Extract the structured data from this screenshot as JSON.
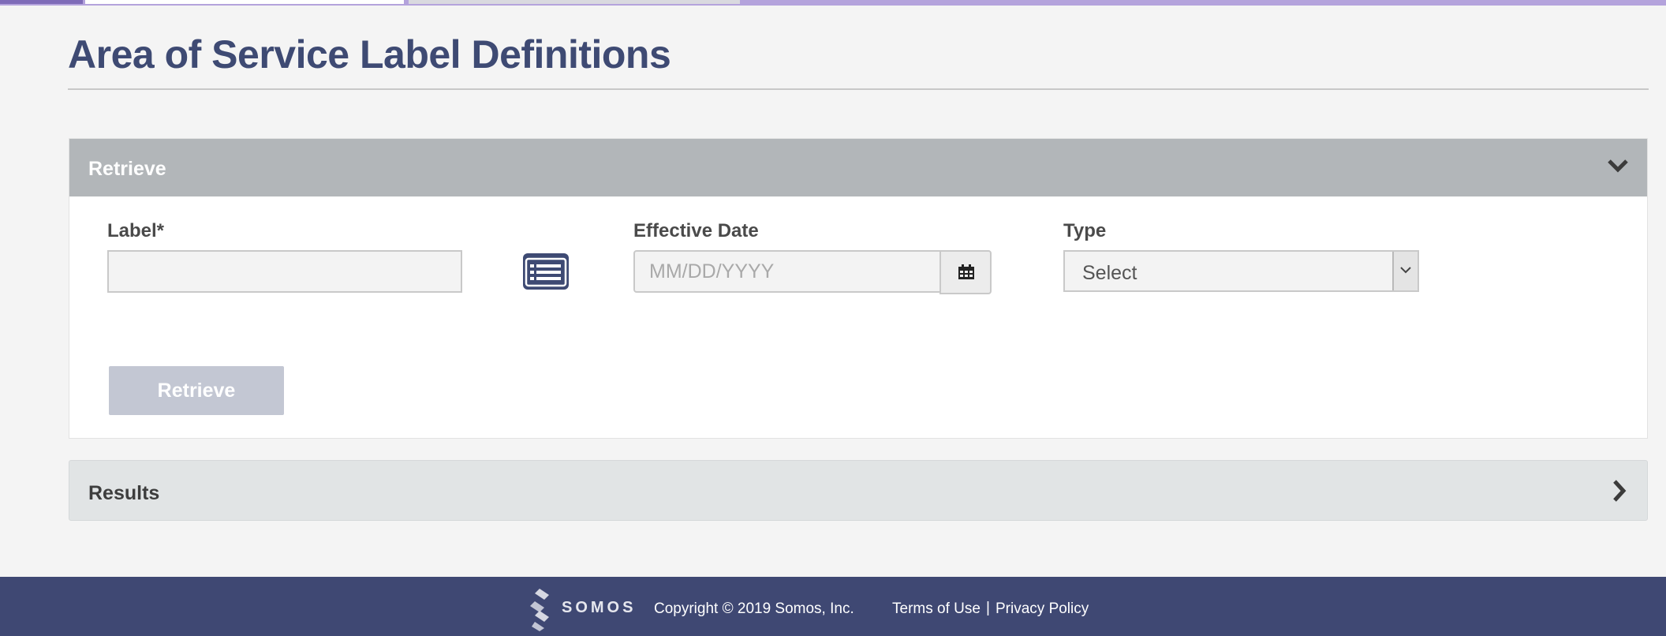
{
  "page": {
    "title": "Area of Service Label Definitions"
  },
  "retrieve_panel": {
    "title": "Retrieve",
    "label_field": {
      "label": "Label*",
      "value": ""
    },
    "effective_date_field": {
      "label": "Effective Date",
      "placeholder": "MM/DD/YYYY"
    },
    "type_field": {
      "label": "Type",
      "selected": "Select"
    },
    "retrieve_button": "Retrieve",
    "retrieve_button_enabled": false
  },
  "results_panel": {
    "title": "Results"
  },
  "footer": {
    "logo_text": "SOMOS",
    "copyright": "Copyright © 2019 Somos, Inc.",
    "terms_link": "Terms of Use",
    "separator": "|",
    "privacy_link": "Privacy Policy"
  },
  "icons": {
    "collapse": "chevron-down-icon",
    "expand": "chevron-right-icon",
    "label_list": "list-icon",
    "date_picker": "calendar-icon",
    "dropdown": "chevron-down-icon"
  },
  "colors": {
    "accent": "#3e4a73",
    "panel_header": "#b2b6b9",
    "footer_bg": "#3f4873",
    "button_disabled": "#c3c7d3"
  }
}
